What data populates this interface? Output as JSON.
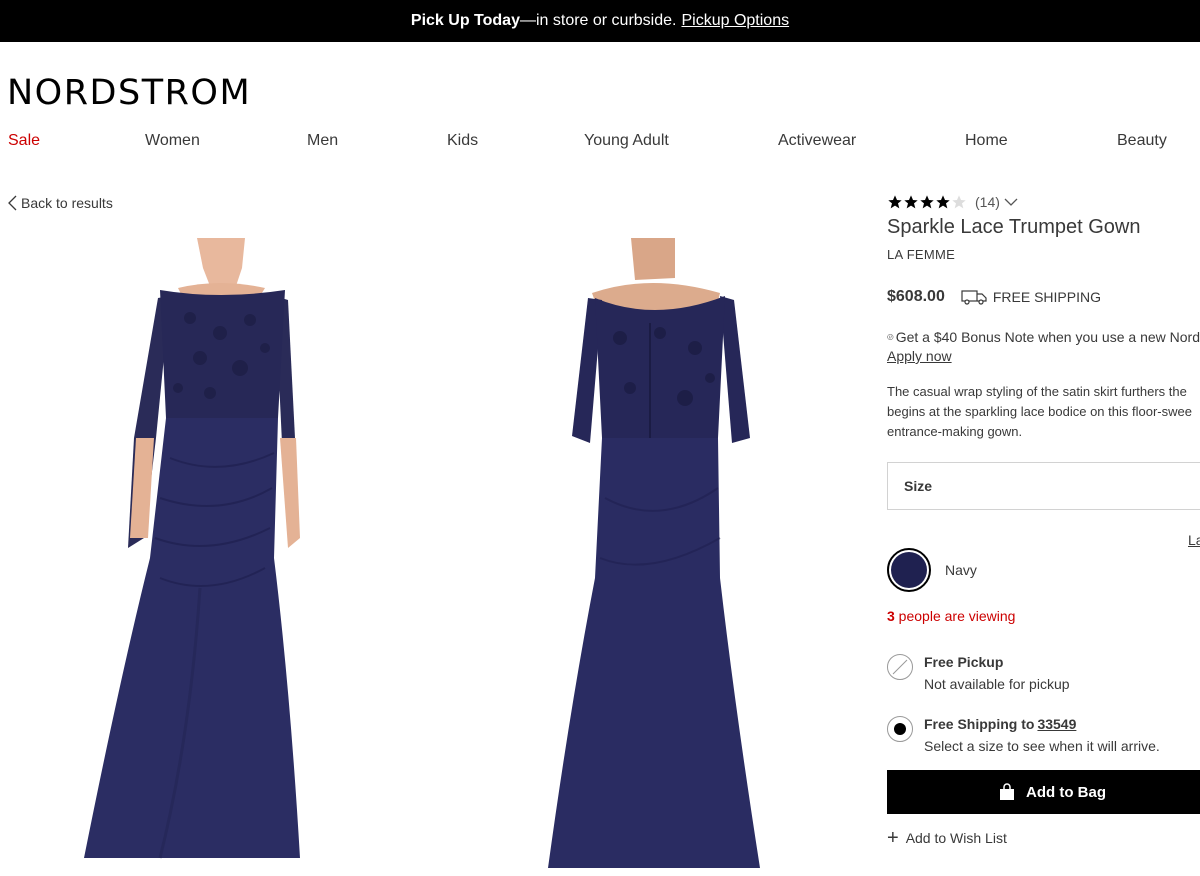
{
  "promo": {
    "bold": "Pick Up Today",
    "text": "—in store or curbside.",
    "link": "Pickup Options"
  },
  "brand_logo": "NORDSTROM",
  "nav": {
    "items": [
      "Sale",
      "Women",
      "Men",
      "Kids",
      "Young Adult",
      "Activewear",
      "Home",
      "Beauty"
    ]
  },
  "back_link": "Back to results",
  "product": {
    "rating_stars": 4,
    "review_count": "(14)",
    "title": "Sparkle Lace Trumpet Gown",
    "brand": "LA FEMME",
    "price": "$608.00",
    "shipping": "FREE SHIPPING",
    "bonus_text": "Get a $40 Bonus Note when you use a new Nord",
    "apply_link": "Apply now",
    "description_lines": [
      "The casual wrap styling of the satin skirt furthers the",
      "begins at the sparkling lace bodice on this floor-swee",
      "entrance-making gown."
    ],
    "size_label": "Size",
    "size_guide": "La",
    "color_name": "Navy",
    "color_hex": "#1f2150",
    "viewing_count": "3",
    "viewing_text": " people are viewing",
    "pickup": {
      "title": "Free Pickup",
      "subtitle": "Not available for pickup"
    },
    "shipping_option": {
      "title": "Free Shipping to",
      "zip": "33549",
      "subtitle": "Select a size to see when it will arrive."
    },
    "add_to_bag": "Add to Bag",
    "wish_list": "Add to Wish List"
  }
}
